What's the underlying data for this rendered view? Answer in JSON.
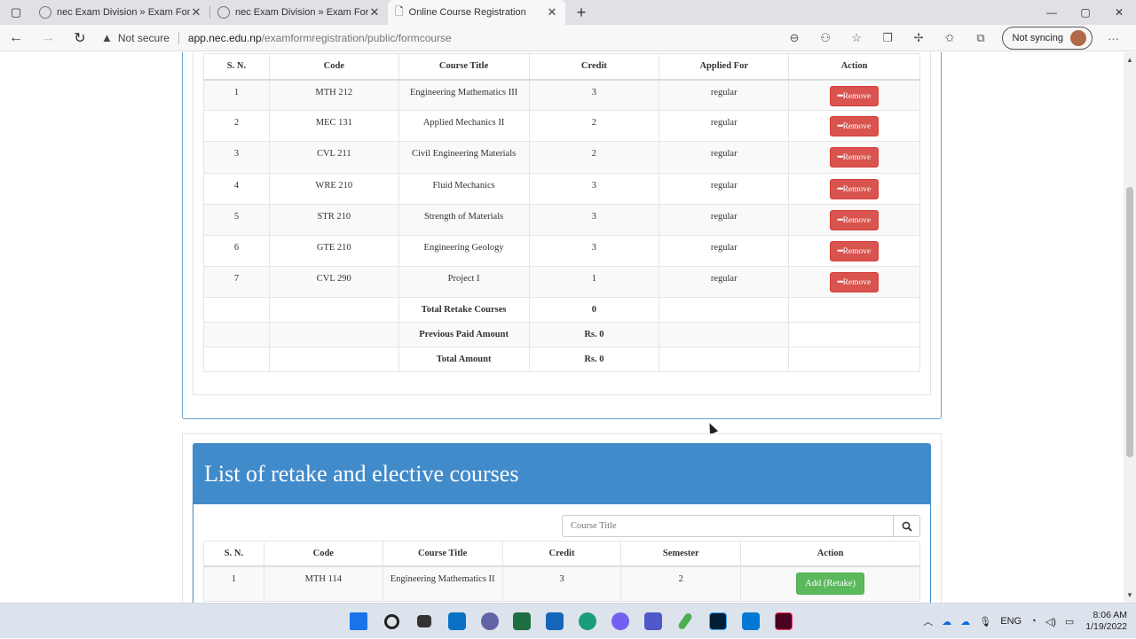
{
  "browser": {
    "tabs": [
      {
        "title": "nec Exam Division » Exam Form",
        "active": false
      },
      {
        "title": "nec Exam Division » Exam Form",
        "active": false
      },
      {
        "title": "Online Course Registration",
        "active": true
      }
    ],
    "security_label": "Not secure",
    "url_host": "app.nec.edu.np",
    "url_path": "/examformregistration/public/formcourse",
    "sync_label": "Not syncing"
  },
  "registered": {
    "headers": [
      "S. N.",
      "Code",
      "Course Title",
      "Credit",
      "Applied For",
      "Action"
    ],
    "rows": [
      {
        "sn": "1",
        "code": "MTH 212",
        "title": "Engineering Mathematics III",
        "credit": "3",
        "applied": "regular"
      },
      {
        "sn": "2",
        "code": "MEC 131",
        "title": "Applied Mechanics II",
        "credit": "2",
        "applied": "regular"
      },
      {
        "sn": "3",
        "code": "CVL 211",
        "title": "Civil Engineering Materials",
        "credit": "2",
        "applied": "regular"
      },
      {
        "sn": "4",
        "code": "WRE 210",
        "title": "Fluid Mechanics",
        "credit": "3",
        "applied": "regular"
      },
      {
        "sn": "5",
        "code": "STR 210",
        "title": "Strength of Materials",
        "credit": "3",
        "applied": "regular"
      },
      {
        "sn": "6",
        "code": "GTE 210",
        "title": "Engineering Geology",
        "credit": "3",
        "applied": "regular"
      },
      {
        "sn": "7",
        "code": "CVL 290",
        "title": "Project I",
        "credit": "1",
        "applied": "regular"
      }
    ],
    "remove_label": "Remove",
    "summary": [
      {
        "label": "Total Retake Courses",
        "value": "0"
      },
      {
        "label": "Previous Paid Amount",
        "value": "Rs. 0"
      },
      {
        "label": "Total Amount",
        "value": "Rs. 0"
      }
    ]
  },
  "retake": {
    "title": "List of retake and elective courses",
    "search_placeholder": "Course Title",
    "headers": [
      "S. N.",
      "Code",
      "Course Title",
      "Credit",
      "Semester",
      "Action"
    ],
    "rows": [
      {
        "sn": "1",
        "code": "MTH 114",
        "title": "Engineering Mathematics II",
        "credit": "3",
        "semester": "2",
        "action": "Add (Retake)"
      }
    ]
  },
  "taskbar": {
    "lang": "ENG",
    "time": "8:06 AM",
    "date": "1/19/2022"
  },
  "colors": {
    "panel_blue": "#428bca",
    "remove_red": "#d9534f",
    "add_green": "#5cb85c"
  }
}
